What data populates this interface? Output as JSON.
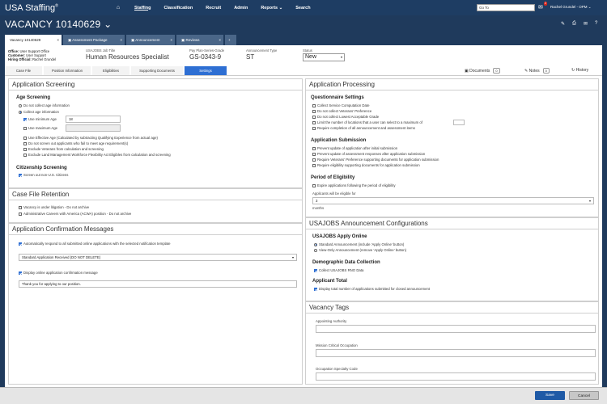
{
  "app": {
    "logo": "USA Staffing",
    "reg": "®"
  },
  "nav": {
    "items": [
      "Staffing",
      "Classification",
      "Recruit",
      "Admin",
      "Reports ⌄",
      "Search"
    ],
    "goto": "Go To",
    "mail_count": "2",
    "user": "Rachel Grundel - OPM ⌄"
  },
  "vacancy": {
    "title": "VACANCY 10140629 ⌄"
  },
  "tabs": [
    "Vacancy 10140629",
    "Assessment Package",
    "Announcement",
    "Reviews",
    "+"
  ],
  "info": {
    "office_label": "Office:",
    "office": "User Support Office",
    "customer_label": "Customer:",
    "customer": "User Support",
    "hiring_label": "Hiring Official:",
    "hiring": "Rachel Grundel",
    "job_title_label": "USAJOBS Job Title",
    "job_title": "Human Resources Specialist",
    "pps_label": "Pay Plan-Series-Grade",
    "pps": "GS-0343-9",
    "ann_label": "Announcement Type",
    "ann": "ST",
    "status_label": "Status",
    "status": "New"
  },
  "crumbs": [
    "Case File",
    "Position Information",
    "Eligibilities",
    "Supporting Documents",
    "Settings"
  ],
  "right_tabs": {
    "documents": "Documents",
    "documents_count": "0",
    "notes": "Notes",
    "notes_count": "0",
    "history": "History"
  },
  "screening": {
    "title": "Application Screening",
    "age_title": "Age Screening",
    "no_collect": "Do not collect age information",
    "collect": "Collect age information",
    "use_min": "Use minimum Age",
    "min_value": "18",
    "use_max": "Use maximum Age",
    "opts": [
      "Use Effective Age (Calculated by subtracting Qualifying Experience from actual age)",
      "Do not screen out applicants who fail to meet age requirement(s)",
      "Exclude Veterans from calculation and screening",
      "Exclude Land Management Workforce Flexibility Act Eligibles from calculation and screening"
    ],
    "citizen_title": "Citizenship Screening",
    "citizen_opt": "Screen out non-U.S. Citizens"
  },
  "retention": {
    "title": "Case File Retention",
    "opts": [
      "Vacancy is under litigation - Do not archive",
      "Administrative Careers with America (ACWA) position - Do not archive"
    ]
  },
  "confirm": {
    "title": "Application Confirmation Messages",
    "auto": "Automatically respond to all submitted online applications with the selected notification template",
    "template": "Standard Application Received (DO NOT DELETE)",
    "display": "Display online application confirmation message",
    "message": "Thank you for applying to our position."
  },
  "processing": {
    "title": "Application Processing",
    "q_title": "Questionnaire Settings",
    "q_opts": [
      "Collect Service Computation Date",
      "Do not collect Veterans' Preference",
      "Do not collect Lowest Acceptable Grade",
      "Limit the number of locations that a user can select to a maximum of",
      "Require completion of all announcement and assessment items"
    ],
    "s_title": "Application Submission",
    "s_opts": [
      "Prevent update of application after initial submission",
      "Prevent update of assessment responses after application submission",
      "Require Veterans' Preference supporting documents for application submission",
      "Require eligibility supporting documents for application submission"
    ],
    "p_title": "Period of Eligibility",
    "p_opt": "Expire applications following the period of eligibility",
    "p_label": "Applicants will be eligible for",
    "p_value": "3",
    "p_unit": "months"
  },
  "usajobs": {
    "title": "USAJOBS Announcement Configurations",
    "apply_title": "USAJOBS Apply Online",
    "apply_std": "Standard Announcement (include 'Apply Online' button)",
    "apply_view": "View-Only Announcement (remove 'Apply Online' button)",
    "demo_title": "Demographic Data Collection",
    "demo_opt": "Collect USAJOBS RNO Data",
    "total_title": "Applicant Total",
    "total_opt": "Display total number of applications submitted for closed announcement"
  },
  "tags": {
    "title": "Vacancy Tags",
    "fields": [
      "Appointing Authority",
      "Mission Critical Occupation",
      "Occupation Specialty Code"
    ]
  },
  "footer": {
    "save": "Save",
    "cancel": "Cancel"
  }
}
